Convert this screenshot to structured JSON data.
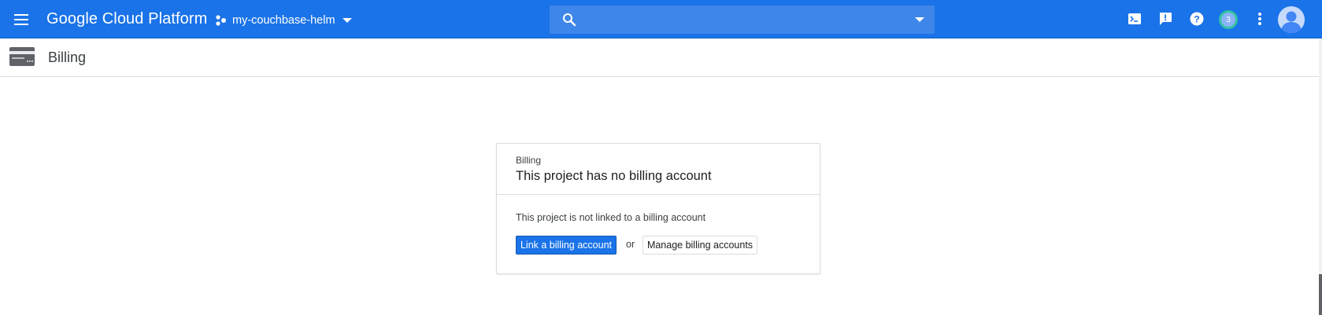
{
  "topbar": {
    "brand": "Google Cloud Platform",
    "project_name": "my-couchbase-helm",
    "search": {
      "value": "",
      "placeholder": ""
    },
    "notification_count": "3",
    "icons": [
      "menu-icon",
      "project-icon",
      "chevron-down-icon",
      "search-icon",
      "chevron-down-icon",
      "cloud-shell-icon",
      "feedback-icon",
      "help-icon",
      "notifications-icon",
      "more-vert-icon",
      "account-icon"
    ],
    "color": "#1a73e8"
  },
  "page": {
    "title": "Billing",
    "icon": "billing-card-icon"
  },
  "card": {
    "eyebrow": "Billing",
    "title": "This project has no billing account",
    "body": "This project is not linked to a billing account",
    "primary_button": "Link a billing account",
    "or": "or",
    "secondary_button": "Manage billing accounts"
  }
}
